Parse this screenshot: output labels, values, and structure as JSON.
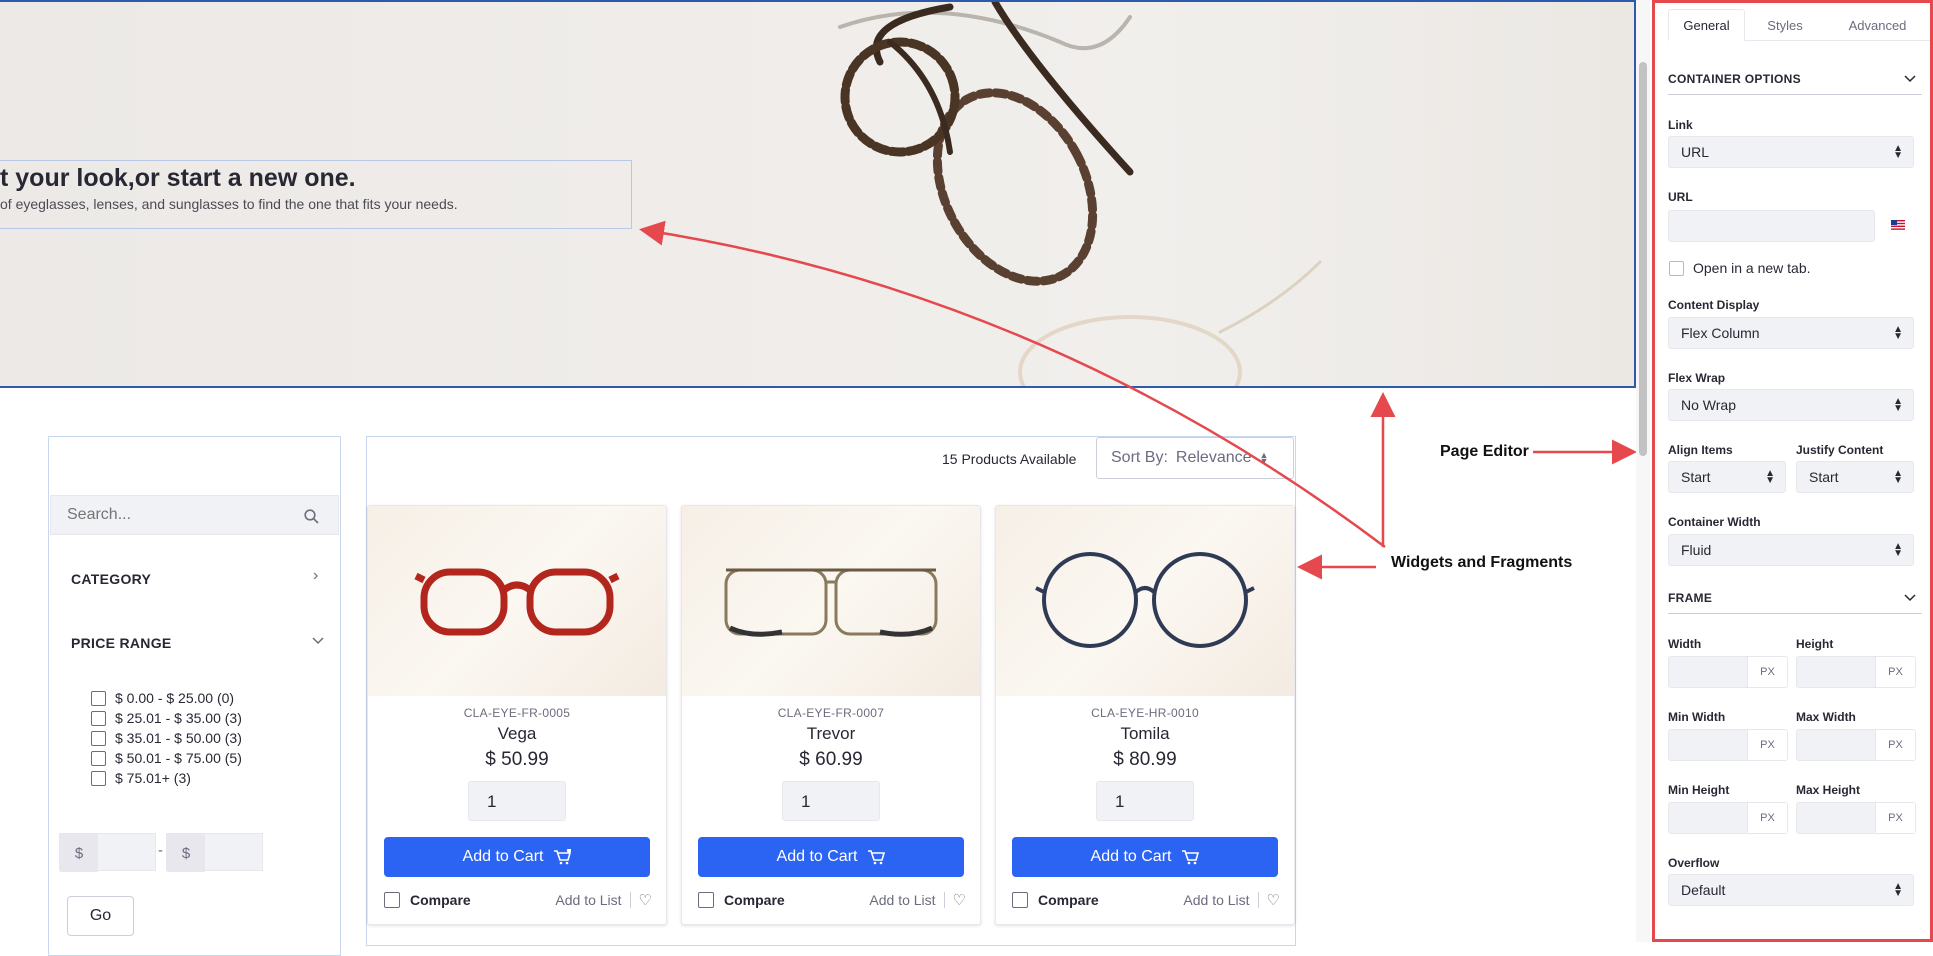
{
  "hero": {
    "title": "t your look,or start a new one.",
    "subtitle": "of eyeglasses, lenses, and sunglasses to find the one that fits your needs."
  },
  "filters": {
    "search_placeholder": "Search...",
    "category_label": "CATEGORY",
    "price_range_label": "PRICE RANGE",
    "ranges": [
      "$ 0.00 - $ 25.00 (0)",
      "$ 25.01 - $ 35.00 (3)",
      "$ 35.01 - $ 50.00 (3)",
      "$ 50.01 - $ 75.00 (5)",
      "$ 75.01+ (3)"
    ],
    "currency": "$",
    "dash": "-",
    "go_label": "Go"
  },
  "listing": {
    "count_text": "15 Products Available",
    "sort_label": "Sort By:",
    "sort_value": "Relevance"
  },
  "products": [
    {
      "sku": "CLA-EYE-FR-0005",
      "name": "Vega",
      "price": "$ 50.99",
      "qty": "1",
      "frame_color": "#b3261e"
    },
    {
      "sku": "CLA-EYE-FR-0007",
      "name": "Trevor",
      "price": "$ 60.99",
      "qty": "1",
      "frame_color": "#8a7a5c"
    },
    {
      "sku": "CLA-EYE-HR-0010",
      "name": "Tomila",
      "price": "$ 80.99",
      "qty": "1",
      "frame_color": "#2f3a55"
    }
  ],
  "product_actions": {
    "add_to_cart": "Add to Cart",
    "compare": "Compare",
    "add_to_list": "Add to List"
  },
  "annotations": {
    "page_editor": "Page Editor",
    "widgets": "Widgets and Fragments",
    "arrow_color": "#e5484d"
  },
  "panel": {
    "tabs": [
      "General",
      "Styles",
      "Advanced"
    ],
    "container_options": "CONTAINER OPTIONS",
    "link_label": "Link",
    "link_value": "URL",
    "url_label": "URL",
    "open_new_tab": "Open in a new tab.",
    "content_display_label": "Content Display",
    "content_display_value": "Flex Column",
    "flex_wrap_label": "Flex Wrap",
    "flex_wrap_value": "No Wrap",
    "align_items_label": "Align Items",
    "align_items_value": "Start",
    "justify_content_label": "Justify Content",
    "justify_content_value": "Start",
    "container_width_label": "Container Width",
    "container_width_value": "Fluid",
    "frame": "FRAME",
    "width_label": "Width",
    "height_label": "Height",
    "min_width_label": "Min Width",
    "max_width_label": "Max Width",
    "min_height_label": "Min Height",
    "max_height_label": "Max Height",
    "unit": "PX",
    "overflow_label": "Overflow",
    "overflow_value": "Default"
  },
  "colors": {
    "primary": "#2b63f3",
    "highlight_border": "#e5484d",
    "selection": "#2e5aac"
  }
}
